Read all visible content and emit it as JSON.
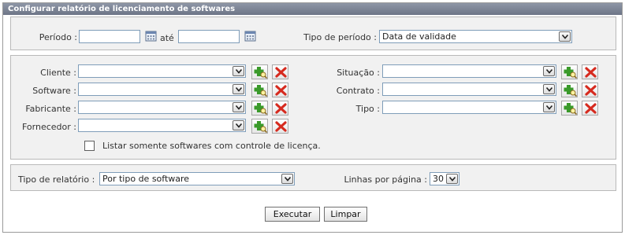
{
  "window": {
    "title": "Configurar relatório de licenciamento de softwares"
  },
  "period": {
    "label": "Período :",
    "start_value": "",
    "between_label": "até",
    "end_value": "",
    "type_label": "Tipo de período :",
    "type_value": "Data de validade"
  },
  "filters": {
    "cliente_label": "Cliente :",
    "software_label": "Software :",
    "fabricante_label": "Fabricante :",
    "fornecedor_label": "Fornecedor :",
    "situacao_label": "Situação :",
    "contrato_label": "Contrato :",
    "tipo_label": "Tipo :",
    "cliente_value": "",
    "software_value": "",
    "fabricante_value": "",
    "fornecedor_value": "",
    "situacao_value": "",
    "contrato_value": "",
    "tipo_value": "",
    "checkbox_label": "Listar somente softwares com controle de licença.",
    "checkbox_checked": false
  },
  "report": {
    "type_label": "Tipo de relatório :",
    "type_value": "Por tipo de software",
    "lines_label": "Linhas por página :",
    "lines_value": "30"
  },
  "actions": {
    "execute_label": "Executar",
    "clear_label": "Limpar"
  },
  "icons": {
    "calendar": "calendar-icon",
    "add": "add-search-icon",
    "remove": "remove-x-icon",
    "dropdown": "chevron-down-icon"
  },
  "colors": {
    "title_bar": "#7a8294",
    "panel_bg": "#f1f1f1",
    "add_green": "#3a9a2a",
    "remove_red": "#d62a1e"
  }
}
